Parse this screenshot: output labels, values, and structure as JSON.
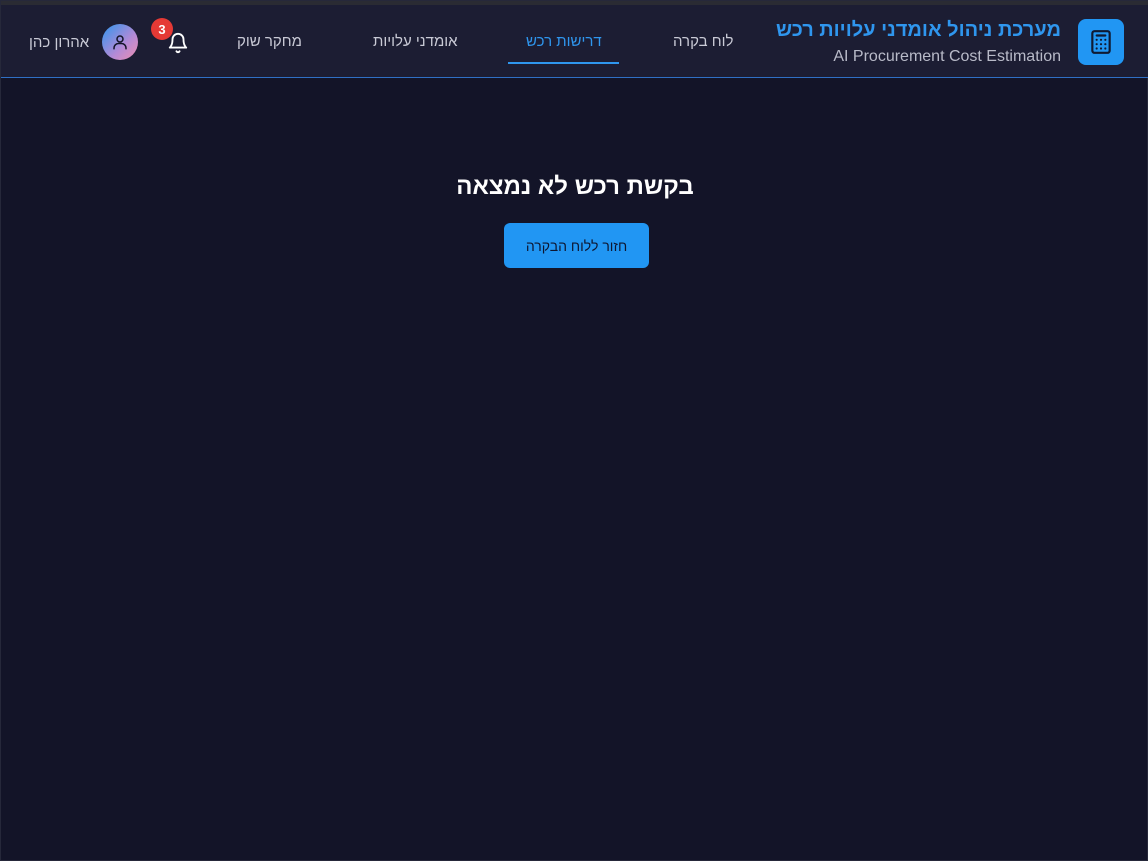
{
  "header": {
    "title": "מערכת ניהול אומדני עלויות רכש",
    "subtitle": "AI Procurement Cost Estimation",
    "brand_icon": "calculator-icon"
  },
  "nav": {
    "items": [
      {
        "label": "לוח בקרה",
        "active": false
      },
      {
        "label": "דרישות רכש",
        "active": true
      },
      {
        "label": "אומדני עלויות",
        "active": false
      },
      {
        "label": "מחקר שוק",
        "active": false
      }
    ]
  },
  "notifications": {
    "icon": "bell-icon",
    "count": "3"
  },
  "user": {
    "name": "אהרון כהן",
    "icon": "user-icon"
  },
  "main": {
    "message": "בקשת רכש לא נמצאה",
    "back_label": "חזור ללוח הבקרה"
  },
  "colors": {
    "background": "#131428",
    "header": "#1c1d33",
    "accent": "#2196f3",
    "badge": "#e53935"
  }
}
